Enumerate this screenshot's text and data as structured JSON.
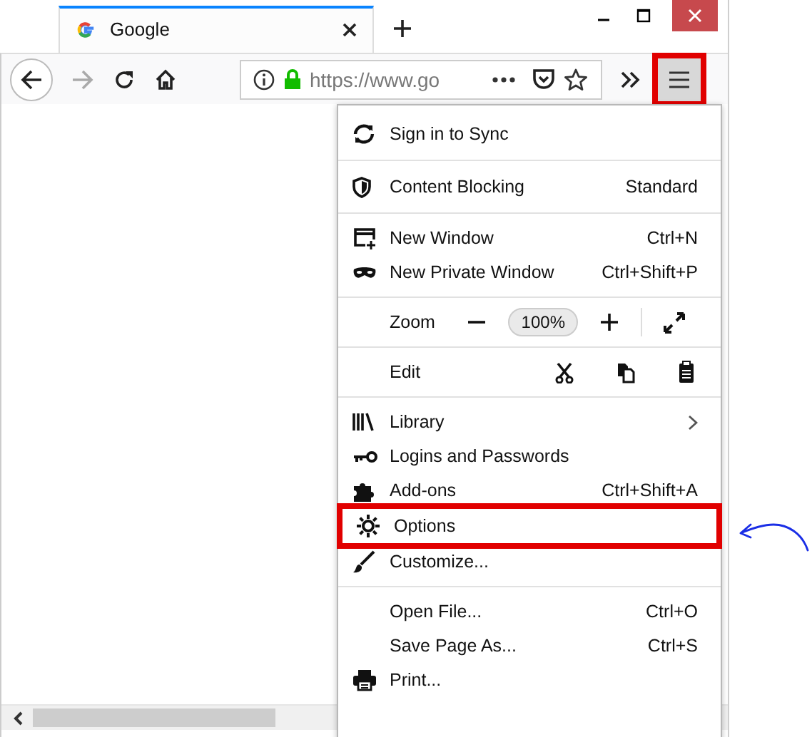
{
  "tab": {
    "title": "Google"
  },
  "toolbar": {
    "url": "https://www.go",
    "menu_button_annotated": true
  },
  "menu": {
    "sections": [
      {
        "items": [
          {
            "kind": "item",
            "label": "Sign in to Sync"
          }
        ]
      },
      {
        "items": [
          {
            "kind": "item",
            "label": "Content Blocking",
            "value": "Standard"
          }
        ]
      },
      {
        "items": [
          {
            "kind": "item",
            "label": "New Window",
            "shortcut": "Ctrl+N"
          },
          {
            "kind": "item",
            "label": "New Private Window",
            "shortcut": "Ctrl+Shift+P"
          }
        ]
      },
      {
        "items": [
          {
            "kind": "zoom",
            "label": "Zoom",
            "value": "100%"
          }
        ]
      },
      {
        "items": [
          {
            "kind": "edit",
            "label": "Edit"
          }
        ]
      },
      {
        "items": [
          {
            "kind": "item",
            "label": "Library",
            "submenu": true
          },
          {
            "kind": "item",
            "label": "Logins and Passwords"
          },
          {
            "kind": "item",
            "label": "Add-ons",
            "shortcut": "Ctrl+Shift+A"
          },
          {
            "kind": "item",
            "label": "Options",
            "annotated": true
          },
          {
            "kind": "item",
            "label": "Customize..."
          }
        ]
      },
      {
        "items": [
          {
            "kind": "item",
            "label": "Open File...",
            "shortcut": "Ctrl+O"
          },
          {
            "kind": "item",
            "label": "Save Page As...",
            "shortcut": "Ctrl+S"
          },
          {
            "kind": "item",
            "label": "Print..."
          }
        ]
      }
    ]
  }
}
